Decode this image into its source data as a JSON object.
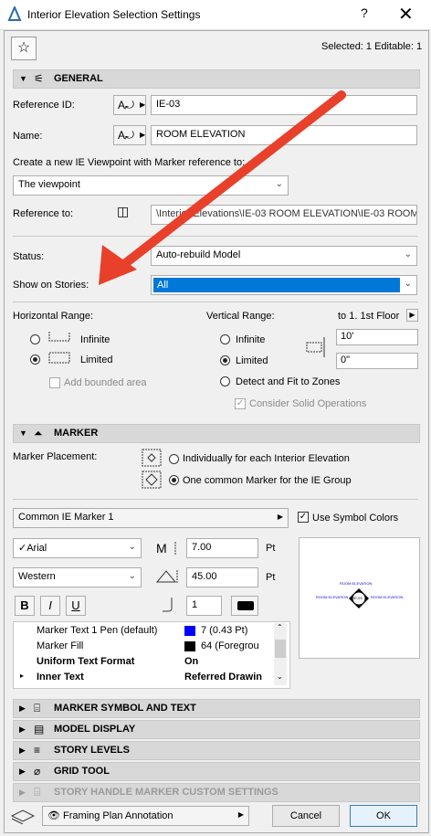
{
  "window": {
    "title": "Interior Elevation Selection Settings",
    "help": "?",
    "close": "✕"
  },
  "header": {
    "selected_text": "Selected: 1 Editable: 1"
  },
  "general": {
    "section_label": "GENERAL",
    "reference_id_label": "Reference ID:",
    "reference_id_value": "IE-03",
    "name_label": "Name:",
    "name_value": "ROOM ELEVATION",
    "create_label": "Create a new IE Viewpoint with Marker reference to:",
    "create_value": "The viewpoint",
    "reference_to_label": "Reference to:",
    "reference_to_value": "\\Interior Elevations\\IE-03 ROOM ELEVATION\\IE-03 ROOM",
    "status_label": "Status:",
    "status_value": "Auto-rebuild Model",
    "show_on_stories_label": "Show on Stories:",
    "show_on_stories_value": "All",
    "horizontal_range_label": "Horizontal Range:",
    "h_infinite": "Infinite",
    "h_limited": "Limited",
    "add_bounded_area": "Add bounded area",
    "vertical_range_label": "Vertical Range:",
    "to_story": "to 1. 1st Floor",
    "v_infinite": "Infinite",
    "v_limited": "Limited",
    "v_top_value": "10'",
    "v_bottom_value": "0\"",
    "detect_fit": "Detect and Fit to Zones",
    "consider_solid": "Consider Solid Operations"
  },
  "marker": {
    "section_label": "MARKER",
    "placement_label": "Marker Placement:",
    "individually": "Individually for each Interior Elevation",
    "one_common": "One common Marker for the IE Group",
    "marker_type": "Common IE Marker 1",
    "use_symbol_colors": "Use Symbol Colors",
    "font": "Arial",
    "font_size_value": "7.00",
    "font_size_unit": "Pt",
    "script": "Western",
    "angle_value": "45.00",
    "angle_unit": "Pt",
    "bold": "B",
    "italic": "I",
    "underline": "U",
    "pen_value": "1",
    "preview_label_top": "ROOM ELEVATION",
    "preview_label_left": "ROOM ELEVATION",
    "preview_label_right": "ROOM ELEVATION",
    "preview_center": "IE-03",
    "params": [
      {
        "name": "Marker Text 1 Pen (default)",
        "value": "7 (0.43 Pt)",
        "swatch": "#0000ff",
        "bold": false,
        "expand": ""
      },
      {
        "name": "Marker Fill",
        "value": "64 (Foregrou",
        "swatch": "#000000",
        "bold": false,
        "expand": ""
      },
      {
        "name": "Uniform Text Format",
        "value": "On",
        "swatch": "",
        "bold": true,
        "expand": ""
      },
      {
        "name": "Inner Text",
        "value": "Referred Drawin",
        "swatch": "",
        "bold": true,
        "expand": "▸"
      }
    ]
  },
  "collapsed_sections": [
    {
      "label": "MARKER SYMBOL AND TEXT",
      "icon": "symbol-text-icon",
      "dim": false
    },
    {
      "label": "MODEL DISPLAY",
      "icon": "model-display-icon",
      "dim": false
    },
    {
      "label": "STORY LEVELS",
      "icon": "story-levels-icon",
      "dim": false
    },
    {
      "label": "GRID TOOL",
      "icon": "grid-tool-icon",
      "dim": false
    },
    {
      "label": "STORY HANDLE MARKER CUSTOM SETTINGS",
      "icon": "story-handle-icon",
      "dim": true
    }
  ],
  "footer": {
    "layer": "Framing Plan Annotation",
    "cancel": "Cancel",
    "ok": "OK"
  },
  "colors": {
    "selection_blue": "#0078d7",
    "annotation_red": "#e8402a"
  }
}
